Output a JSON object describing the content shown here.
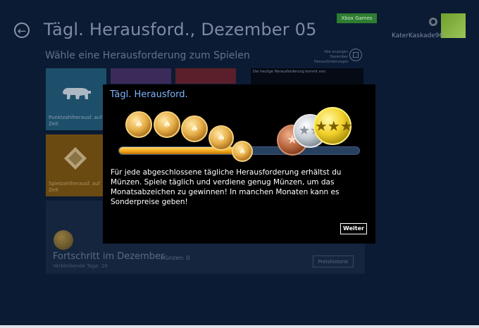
{
  "header": {
    "title": "Tägl. Herausford., Dezember 05",
    "back_icon": "back-arrow-icon",
    "xbox_games_label": "Xbox Games",
    "gamertag": "KaterKaskade96"
  },
  "subtitle": "Wähle eine Herausforderung zum Spielen",
  "view_all": "Alle anzeigen Dezember Herausforderungen",
  "tiles": [
    {
      "label": "Punktzahlherausf. auf Zeit"
    },
    {
      "label": "Spielzahlherausf. auf Zeit"
    }
  ],
  "today_panel": "Die heutige Herausforderung kommt von:",
  "progress": {
    "title": "Fortschritt im Dezember",
    "coins_label": "Münzen: 0",
    "days_left": "Verbleibende Tage: 26",
    "history_button": "Preishistorie"
  },
  "dialog": {
    "title": "Tägl. Herausford.",
    "body": "Für jede abgeschlossene tägliche Herausforderung erhältst du Münzen. Spiele täglich und verdiene genug Münzen, um das Monatsabzeichen zu gewinnen! In manchen Monaten kann es Sonderpreise geben!",
    "next_button": "Weiter",
    "progress_fraction": 0.52
  },
  "colors": {
    "background": "#0b1b33",
    "accent_blue": "#7fb4ff",
    "xbox_green": "#2e7d32",
    "gold": "#f0a215"
  }
}
